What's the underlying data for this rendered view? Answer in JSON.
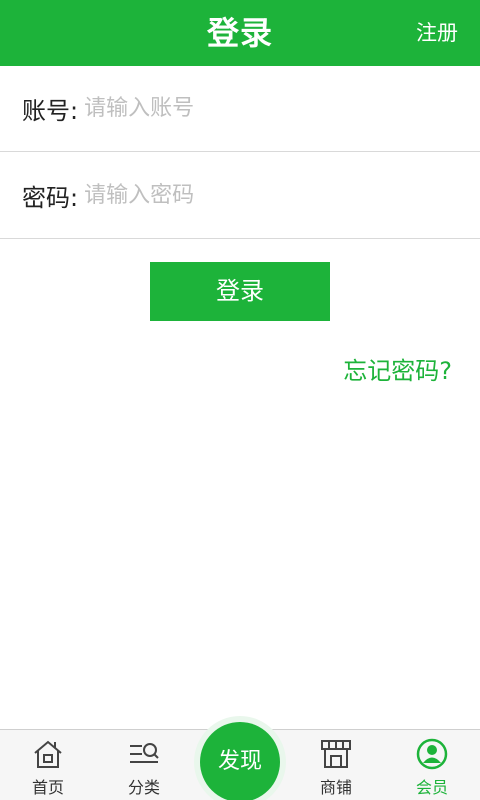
{
  "header": {
    "title": "登录",
    "register_label": "注册"
  },
  "form": {
    "account": {
      "label": "账号:",
      "placeholder": "请输入账号",
      "value": ""
    },
    "password": {
      "label": "密码:",
      "placeholder": "请输入密码",
      "value": ""
    },
    "login_button": "登录",
    "forgot_password": "忘记密码?"
  },
  "tabbar": {
    "items": [
      {
        "label": "首页",
        "icon": "home-icon",
        "active": false
      },
      {
        "label": "分类",
        "icon": "category-icon",
        "active": false
      },
      {
        "label": "发现",
        "icon": "discover-button",
        "active": false
      },
      {
        "label": "商铺",
        "icon": "shop-icon",
        "active": false
      },
      {
        "label": "会员",
        "icon": "member-icon",
        "active": true
      }
    ]
  },
  "colors": {
    "brand_green": "#1db33a",
    "placeholder_gray": "#bfbfbf"
  }
}
